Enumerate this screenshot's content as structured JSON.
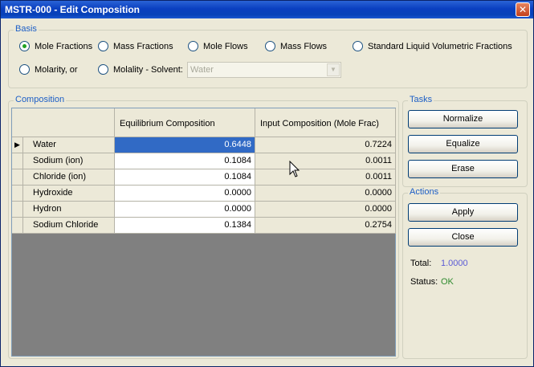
{
  "window": {
    "title": "MSTR-000 - Edit Composition",
    "close_glyph": "✕"
  },
  "basis": {
    "label": "Basis",
    "options": [
      {
        "label": "Mole Fractions",
        "selected": true
      },
      {
        "label": "Mass Fractions",
        "selected": false
      },
      {
        "label": "Mole Flows",
        "selected": false
      },
      {
        "label": "Mass Flows",
        "selected": false
      },
      {
        "label": "Standard Liquid Volumetric Fractions",
        "selected": false
      },
      {
        "label": "Molarity, or",
        "selected": false
      },
      {
        "label": "Molality - Solvent:",
        "selected": false
      }
    ],
    "solvent": {
      "value": "Water",
      "disabled": true
    }
  },
  "composition": {
    "label": "Composition",
    "columns": [
      "Equilibrium Composition",
      "Input Composition (Mole Frac)"
    ],
    "rows": [
      {
        "name": "Water",
        "equilibrium": "0.6448",
        "input": "0.7224",
        "current": true
      },
      {
        "name": "Sodium (ion)",
        "equilibrium": "0.1084",
        "input": "0.0011"
      },
      {
        "name": "Chloride (ion)",
        "equilibrium": "0.1084",
        "input": "0.0011"
      },
      {
        "name": "Hydroxide",
        "equilibrium": "0.0000",
        "input": "0.0000"
      },
      {
        "name": "Hydron",
        "equilibrium": "0.0000",
        "input": "0.0000"
      },
      {
        "name": "Sodium Chloride",
        "equilibrium": "0.1384",
        "input": "0.2754"
      }
    ],
    "current_row_glyph": "▶"
  },
  "tasks": {
    "label": "Tasks",
    "normalize": "Normalize",
    "equalize": "Equalize",
    "erase": "Erase"
  },
  "actions": {
    "label": "Actions",
    "apply": "Apply",
    "close": "Close",
    "total_label": "Total:",
    "total_value": "1.0000",
    "status_label": "Status:",
    "status_value": "OK"
  },
  "colors": {
    "title_bar": "#0a3fc0",
    "selection": "#316ac5",
    "total_value": "#5b5bd6",
    "status_ok": "#2e8b2e",
    "group_label": "#1c5ec6"
  }
}
